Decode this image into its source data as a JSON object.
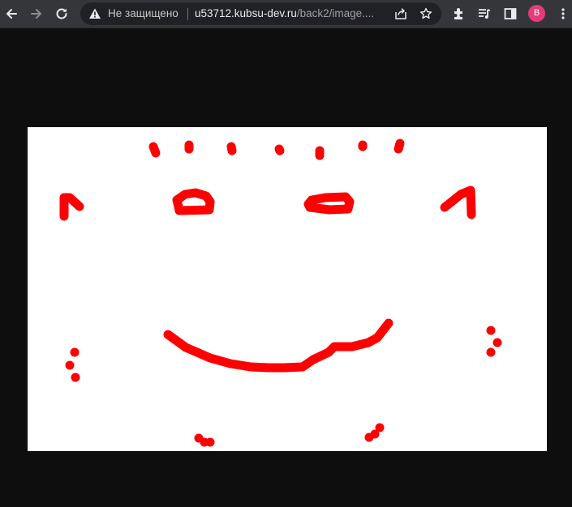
{
  "browser": {
    "nav": {
      "back_icon": "arrow-left-icon",
      "forward_icon": "arrow-right-icon",
      "reload_icon": "reload-icon"
    },
    "omnibox": {
      "security_icon": "warning-triangle-icon",
      "security_label": "Не защищено",
      "url_host": "u53712.kubsu-dev.ru",
      "url_path": "/back2/image...."
    },
    "actions": {
      "share_icon": "share-icon",
      "bookmark_icon": "star-icon",
      "extensions_icon": "puzzle-icon",
      "media_icon": "playlist-icon",
      "sidepanel_icon": "side-panel-icon",
      "menu_icon": "kebab-menu-icon"
    },
    "profile": {
      "initial": "B",
      "color": "#e53b78"
    }
  },
  "page": {
    "background": "#0e0e0e",
    "image": {
      "description_type": "red freehand smiley drawing on white canvas",
      "stroke_color": "#ff0000",
      "background_color": "#ffffff"
    }
  }
}
